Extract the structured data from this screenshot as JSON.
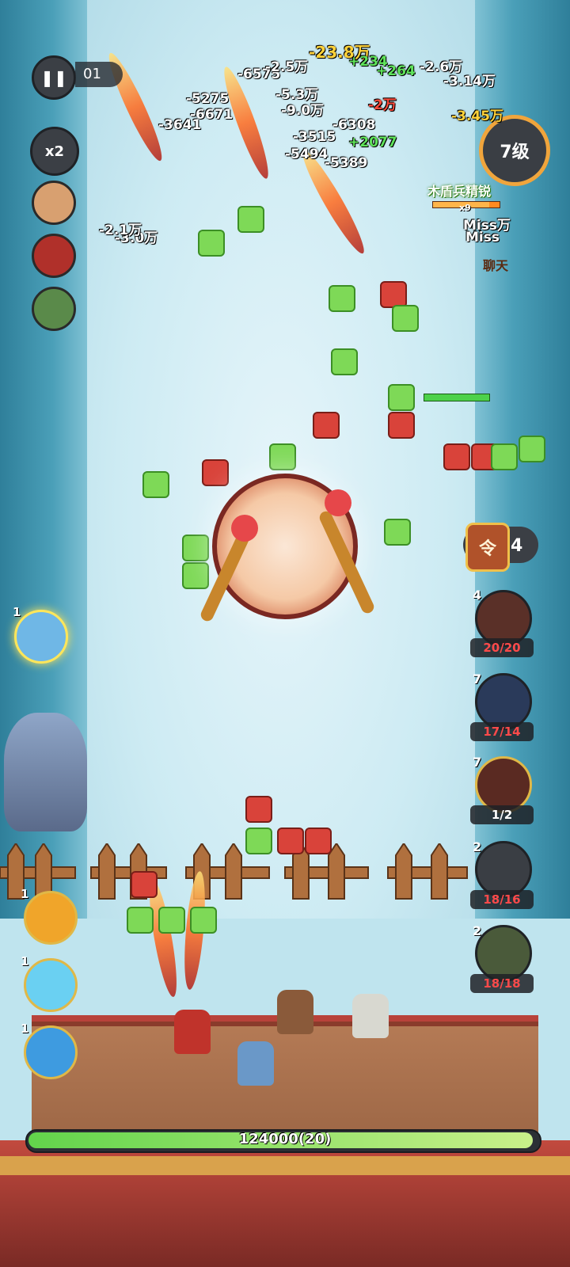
{
  "hud": {
    "pause_glyph": "❚❚",
    "timer": "01",
    "speed": "x2",
    "level": "7级",
    "chat": "聊天",
    "enemy_name": "木盾兵精锐",
    "enemy_stack": "x9",
    "enemy_hp_fraction": 0.85
  },
  "damage_numbers": [
    {
      "text": "-23.8万",
      "style": "gold"
    },
    {
      "text": "+234",
      "style": "green"
    },
    {
      "text": "-2.6万",
      "style": "white"
    },
    {
      "text": "-6575",
      "style": "white"
    },
    {
      "text": "-2.5万",
      "style": "white"
    },
    {
      "text": "+264",
      "style": "green"
    },
    {
      "text": "-3.14万",
      "style": "white"
    },
    {
      "text": "-5.3万",
      "style": "white"
    },
    {
      "text": "-5275",
      "style": "white"
    },
    {
      "text": "-6671",
      "style": "white"
    },
    {
      "text": "-3641",
      "style": "white"
    },
    {
      "text": "-9.0万",
      "style": "white"
    },
    {
      "text": "-2万",
      "style": "red"
    },
    {
      "text": "-3.45万",
      "style": "gold"
    },
    {
      "text": "-6308",
      "style": "white"
    },
    {
      "text": "-3515",
      "style": "white"
    },
    {
      "text": "+2077",
      "style": "green"
    },
    {
      "text": "-5494",
      "style": "white"
    },
    {
      "text": "-5389",
      "style": "white"
    },
    {
      "text": "-3.0万",
      "style": "white"
    },
    {
      "text": "-2.1万",
      "style": "white"
    },
    {
      "text": "Miss万",
      "style": "white"
    },
    {
      "text": "Miss",
      "style": "white"
    }
  ],
  "token": {
    "glyph": "令",
    "count": "4"
  },
  "units": [
    {
      "level": "4",
      "count": "20/20",
      "color": "red"
    },
    {
      "level": "7",
      "count": "17/14",
      "color": "red"
    },
    {
      "level": "7",
      "count": "1/2",
      "color": "white"
    },
    {
      "level": "2",
      "count": "18/16",
      "color": "red"
    },
    {
      "level": "2",
      "count": "18/18",
      "color": "red"
    }
  ],
  "skills": [
    {
      "num": "1",
      "icon": "storm-spirit-icon",
      "color": "#6fb7e6"
    },
    {
      "num": "1",
      "icon": "fire-orb-icon",
      "color": "#f0a52a"
    },
    {
      "num": "1",
      "icon": "ice-shard-icon",
      "color": "#6ad0f2"
    },
    {
      "num": "1",
      "icon": "water-wave-icon",
      "color": "#3e9be0"
    }
  ],
  "base_hp": {
    "text": "124000(20)",
    "fraction": 0.995
  },
  "colors": {
    "accent": "#f0a53c",
    "hp_green": "#62d44b",
    "damage_gold": "#ffd23a"
  }
}
